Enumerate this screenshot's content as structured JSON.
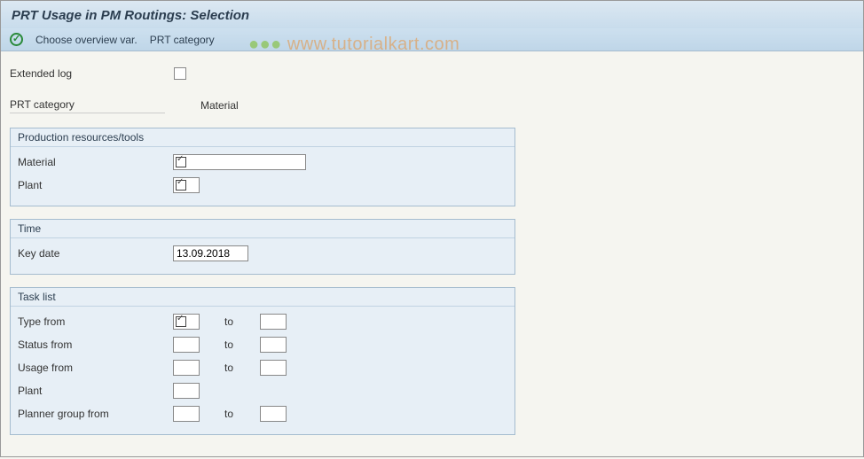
{
  "title": "PRT Usage in PM Routings: Selection",
  "toolbar": {
    "choose_overview": "Choose overview var.",
    "prt_category": "PRT category"
  },
  "watermark": "www.tutorialkart.com",
  "fields": {
    "extended_log_label": "Extended log",
    "prt_category_label": "PRT category",
    "prt_category_value": "Material"
  },
  "group_prt": {
    "title": "Production resources/tools",
    "material_label": "Material",
    "material_value": "",
    "plant_label": "Plant",
    "plant_value": ""
  },
  "group_time": {
    "title": "Time",
    "key_date_label": "Key date",
    "key_date_value": "13.09.2018"
  },
  "group_task": {
    "title": "Task list",
    "to_label": "to",
    "type_from_label": "Type from",
    "type_from_value": "",
    "type_to_value": "",
    "status_from_label": "Status from",
    "status_from_value": "",
    "status_to_value": "",
    "usage_from_label": "Usage from",
    "usage_from_value": "",
    "usage_to_value": "",
    "plant_label": "Plant",
    "plant_value": "",
    "planner_from_label": "Planner group from",
    "planner_from_value": "",
    "planner_to_value": ""
  }
}
